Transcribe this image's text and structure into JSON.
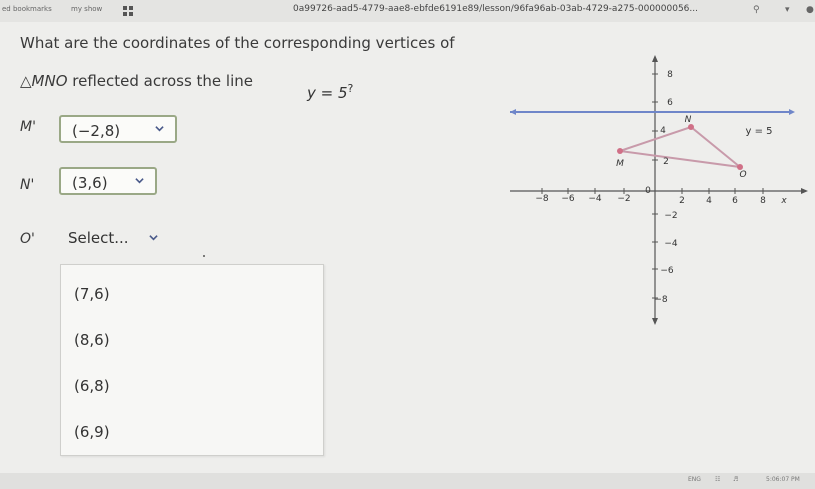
{
  "topbar": {
    "bookmarks": "ed bookmarks",
    "myshow": "my show",
    "url": "0a99726-aad5-4779-aae8-ebfde6191e89/lesson/96fa96ab-03ab-4729-a275-000000056..."
  },
  "question": {
    "line1": "What are the coordinates of the corresponding vertices of",
    "triangle": "△MNO",
    "line2_rest": " reflected across the line ",
    "equation": "y = 5",
    "qmark": "?"
  },
  "answers": [
    {
      "label": "M'",
      "value": "(−2,8)"
    },
    {
      "label": "N'",
      "value": "(3,6)"
    },
    {
      "label": "O'",
      "value": "Select..."
    }
  ],
  "menu_options": [
    "(7,6)",
    "(8,6)",
    "(6,8)",
    "(6,9)"
  ],
  "graph": {
    "x_ticks": [
      "−8",
      "−6",
      "−4",
      "−2",
      "0",
      "2",
      "4",
      "6",
      "8"
    ],
    "y_ticks": [
      "8",
      "6",
      "4",
      "2",
      "−2",
      "−4",
      "−6",
      "−8"
    ],
    "x_axis_label": "x",
    "line_label": "y = 5",
    "vertex_labels": [
      "M",
      "N",
      "O"
    ],
    "colors": {
      "axis": "#555555",
      "line": "#6f86c9",
      "triangle": "#c89aaa",
      "vertex": "#d07087"
    }
  },
  "statusbar": {
    "lang": "ENG",
    "time": "5:06:07 PM"
  }
}
